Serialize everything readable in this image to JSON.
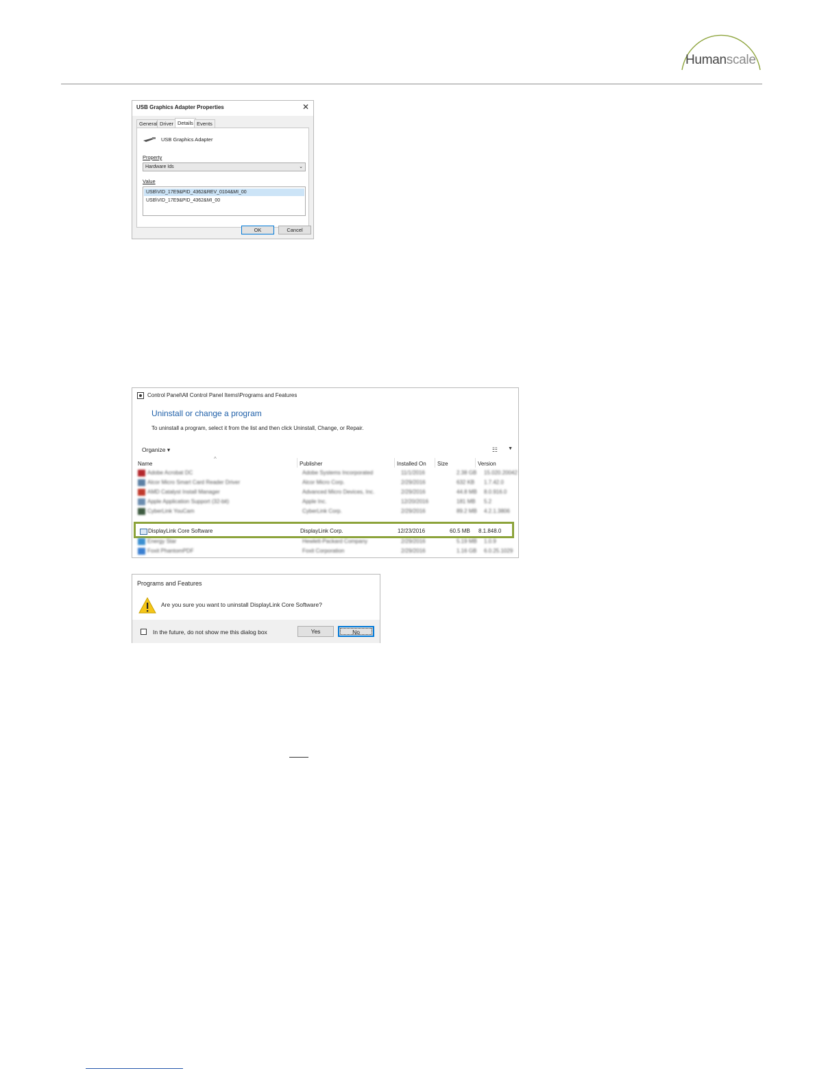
{
  "header": {
    "logo_text_dark": "Human",
    "logo_text_light": "scale",
    "logo_arc_color": "#8ca33a"
  },
  "device_dialog": {
    "title": "USB Graphics Adapter Properties",
    "close_glyph": "✕",
    "tabs": [
      "General",
      "Driver",
      "Details",
      "Events"
    ],
    "active_tab": "Details",
    "device_name": "USB Graphics Adapter",
    "property_label": "Property",
    "property_value": "Hardware Ids",
    "value_label": "Value",
    "values": [
      "USB\\VID_17E9&PID_4362&REV_0104&MI_00",
      "USB\\VID_17E9&PID_4362&MI_00"
    ],
    "ok_label": "OK",
    "cancel_label": "Cancel"
  },
  "control_panel": {
    "path": "Control Panel\\All Control Panel Items\\Programs and Features",
    "heading": "Uninstall or change a program",
    "subheading": "To uninstall a program, select it from the list and then click Uninstall, Change, or Repair.",
    "organize_label": "Organize ▾",
    "columns": [
      "Name",
      "Publisher",
      "Installed On",
      "Size",
      "Version"
    ],
    "rows": [
      {
        "name": "Adobe Acrobat DC",
        "publisher": "Adobe Systems Incorporated",
        "date": "11/1/2016",
        "size": "2.38 GB",
        "version": "15.020.20042",
        "icon_color": "#b3262b"
      },
      {
        "name": "Alcor Micro Smart Card Reader Driver",
        "publisher": "Alcor Micro Corp.",
        "date": "2/29/2016",
        "size": "632 KB",
        "version": "1.7.42.0",
        "icon_color": "#5b7fa3"
      },
      {
        "name": "AMD Catalyst Install Manager",
        "publisher": "Advanced Micro Devices, Inc.",
        "date": "2/29/2016",
        "size": "44.8 MB",
        "version": "8.0.916.0",
        "icon_color": "#c0392b"
      },
      {
        "name": "Apple Application Support (32-bit)",
        "publisher": "Apple Inc.",
        "date": "12/20/2016",
        "size": "181 MB",
        "version": "5.2",
        "icon_color": "#6a8caf"
      },
      {
        "name": "CyberLink YouCam",
        "publisher": "CyberLink Corp.",
        "date": "2/29/2016",
        "size": "89.2 MB",
        "version": "4.2.1.3806",
        "icon_color": "#3d5a40"
      }
    ],
    "highlighted_row": {
      "name": "DisplayLink Core Software",
      "publisher": "DisplayLink Corp.",
      "date": "12/23/2016",
      "size": "60.5 MB",
      "version": "8.1.848.0"
    },
    "rows_after": [
      {
        "name": "Energy Star",
        "publisher": "Hewlett-Packard Company",
        "date": "2/29/2016",
        "size": "5.19 MB",
        "version": "1.0.9",
        "icon_color": "#3a8fd1"
      },
      {
        "name": "Foxit PhantomPDF",
        "publisher": "Foxit Corporation",
        "date": "2/29/2016",
        "size": "1.16 GB",
        "version": "6.0.25.1029",
        "icon_color": "#3a7fd1"
      }
    ],
    "highlight_color": "#8ca33a"
  },
  "confirm_dialog": {
    "title": "Programs and Features",
    "message": "Are you sure you want to uninstall DisplayLink Core Software?",
    "dont_show_label": "In the future, do not show me this dialog box",
    "yes_label": "Yes",
    "no_label": "No"
  }
}
